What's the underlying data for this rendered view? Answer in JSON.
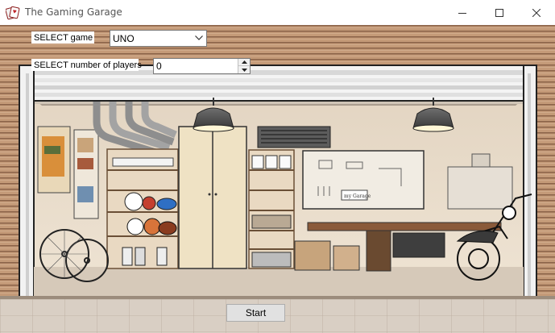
{
  "window": {
    "title": "The Gaming Garage",
    "app_icon": "playing-cards-icon",
    "controls": [
      "minimize-icon",
      "maximize-icon",
      "close-icon"
    ]
  },
  "game_select": {
    "label": "SELECT game",
    "value": "UNO"
  },
  "players_select": {
    "label": "SELECT number of players",
    "value": "0"
  },
  "start_button": {
    "label": "Start"
  },
  "garage_sign": {
    "text": "my Garage"
  }
}
